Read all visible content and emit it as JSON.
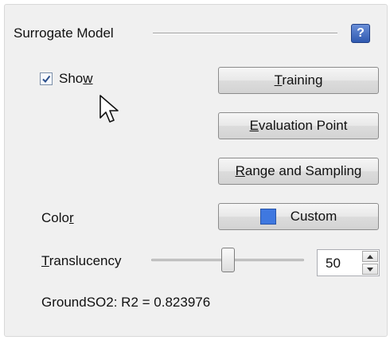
{
  "group": {
    "title": "Surrogate Model",
    "help_glyph": "?"
  },
  "show": {
    "label_pre": "Sho",
    "label_mnemonic": "w",
    "checked": true
  },
  "buttons": {
    "training": {
      "mnemonic": "T",
      "rest": "raining"
    },
    "evaluation": {
      "mnemonic": "E",
      "rest": "valuation Point"
    },
    "range": {
      "mnemonic": "R",
      "rest": "ange and Sampling"
    },
    "color": {
      "label": "Custom",
      "swatch_color": "#3f78e0"
    }
  },
  "color_label": {
    "pre": "Colo",
    "mnemonic": "r"
  },
  "translucency": {
    "mnemonic": "T",
    "rest": "ranslucency",
    "value": "50",
    "slider_fraction": 0.5
  },
  "status": {
    "text": "GroundSO2: R2 = 0.823976"
  },
  "icons": {
    "help": "help-icon",
    "spin_up": "arrow-up-icon",
    "spin_down": "arrow-down-icon",
    "cursor": "mouse-pointer-icon",
    "check": "checkmark-icon"
  }
}
